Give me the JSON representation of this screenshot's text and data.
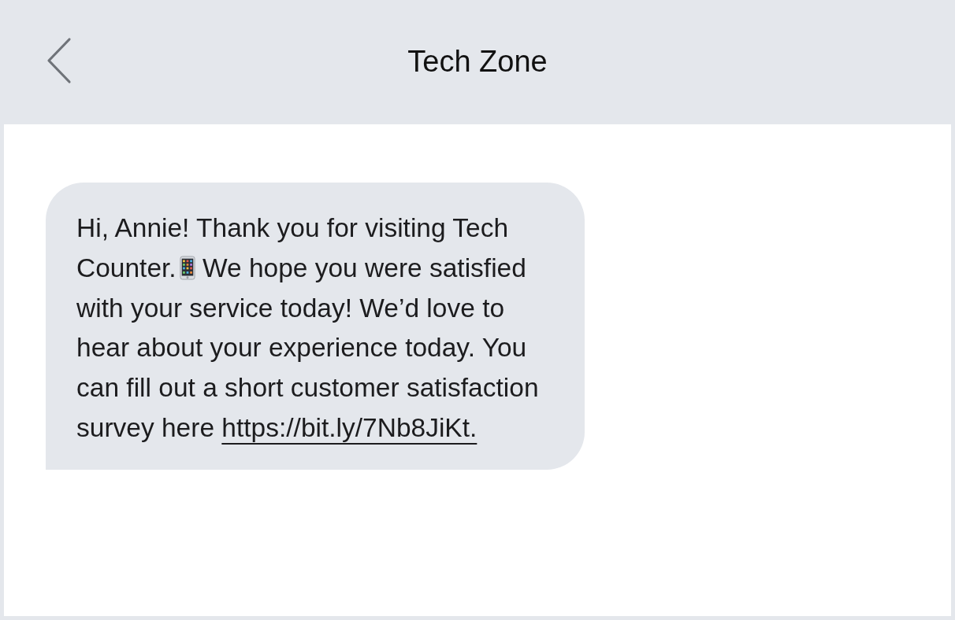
{
  "header": {
    "title": "Tech Zone"
  },
  "messages": [
    {
      "kind": "received",
      "text_before_icon": "Hi, Annie! Thank you for visiting Tech Counter.",
      "text_after_icon": "We hope you were satisfied with your service today! We’d love to hear about your experience today. You can fill out a short customer satisfaction survey here",
      "link": "https://bit.ly/7Nb8JiKt."
    }
  ]
}
